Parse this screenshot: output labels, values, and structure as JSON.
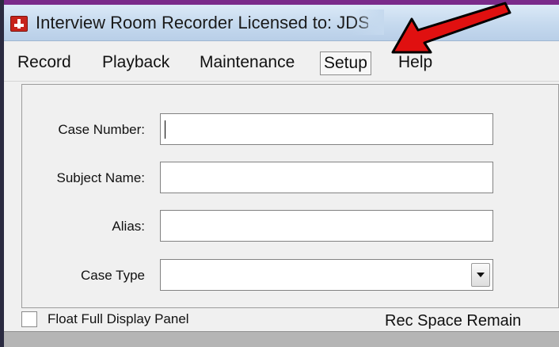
{
  "window": {
    "title": "Interview Room Recorder Licensed to: JDS - All"
  },
  "menu": {
    "items": [
      {
        "label": "Record"
      },
      {
        "label": "Playback"
      },
      {
        "label": "Maintenance"
      },
      {
        "label": "Setup"
      },
      {
        "label": "Help"
      }
    ],
    "active_index": 3
  },
  "form": {
    "case_number": {
      "label": "Case Number:",
      "value": ""
    },
    "subject_name": {
      "label": "Subject Name:",
      "value": ""
    },
    "alias": {
      "label": "Alias:",
      "value": ""
    },
    "case_type": {
      "label": "Case Type",
      "selected": ""
    }
  },
  "footer": {
    "float_panel_label": "Float Full Display Panel",
    "float_panel_checked": false,
    "rec_space_label": "Rec Space Remain"
  },
  "colors": {
    "arrow": "#e01010",
    "app_icon": "#c7241c",
    "titlebar": "#c5d9ee"
  },
  "icons": {
    "app": "app-icon",
    "dropdown": "chevron-down-icon",
    "annotation": "red-arrow-icon"
  }
}
